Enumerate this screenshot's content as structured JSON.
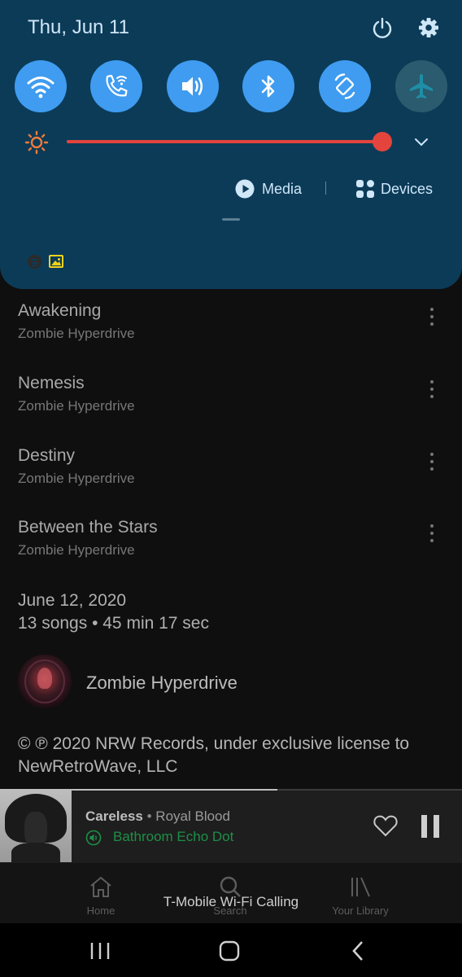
{
  "notification_shade": {
    "date": "Thu, Jun 11",
    "quick_settings": [
      {
        "name": "wifi",
        "icon": "wifi-icon",
        "state": "on"
      },
      {
        "name": "wifi-calling",
        "icon": "wifi-calling-icon",
        "state": "on"
      },
      {
        "name": "sound",
        "icon": "volume-icon",
        "state": "on"
      },
      {
        "name": "bluetooth",
        "icon": "bluetooth-icon",
        "state": "on"
      },
      {
        "name": "auto-rotate",
        "icon": "rotate-icon",
        "state": "on"
      },
      {
        "name": "airplane-mode",
        "icon": "airplane-icon",
        "state": "off"
      }
    ],
    "brightness_level": 0.99,
    "media_label": "Media",
    "devices_label": "Devices",
    "colors": {
      "panel": "#0c3b58",
      "toggle_on": "#3f9cf0",
      "toggle_off": "#2b5b6e",
      "slider": "#e3443c",
      "text": "#cfe7f7"
    }
  },
  "tracks": [
    {
      "title": "Awakening",
      "artist": "Zombie Hyperdrive"
    },
    {
      "title": "Nemesis",
      "artist": "Zombie Hyperdrive"
    },
    {
      "title": "Destiny",
      "artist": "Zombie Hyperdrive"
    },
    {
      "title": "Between the Stars",
      "artist": "Zombie Hyperdrive"
    }
  ],
  "release": {
    "date": "June 12, 2020",
    "summary": "13 songs • 45 min 17 sec"
  },
  "album_artist": "Zombie Hyperdrive",
  "copyright": "© ℗ 2020 NRW Records, under exclusive license to NewRetroWave, LLC",
  "now_playing": {
    "title": "Careless",
    "separator": " • ",
    "artist": "Royal Blood",
    "device": "Bathroom Echo Dot",
    "progress": 0.6,
    "colors": {
      "device": "#1d8f47"
    }
  },
  "tabs": [
    {
      "label": "Home",
      "icon": "home-icon"
    },
    {
      "label": "Search",
      "icon": "search-icon"
    },
    {
      "label": "Your Library",
      "icon": "library-icon"
    }
  ],
  "toast": "T-Mobile Wi-Fi Calling",
  "system_nav": [
    "recents-icon",
    "home-button-icon",
    "back-icon"
  ]
}
